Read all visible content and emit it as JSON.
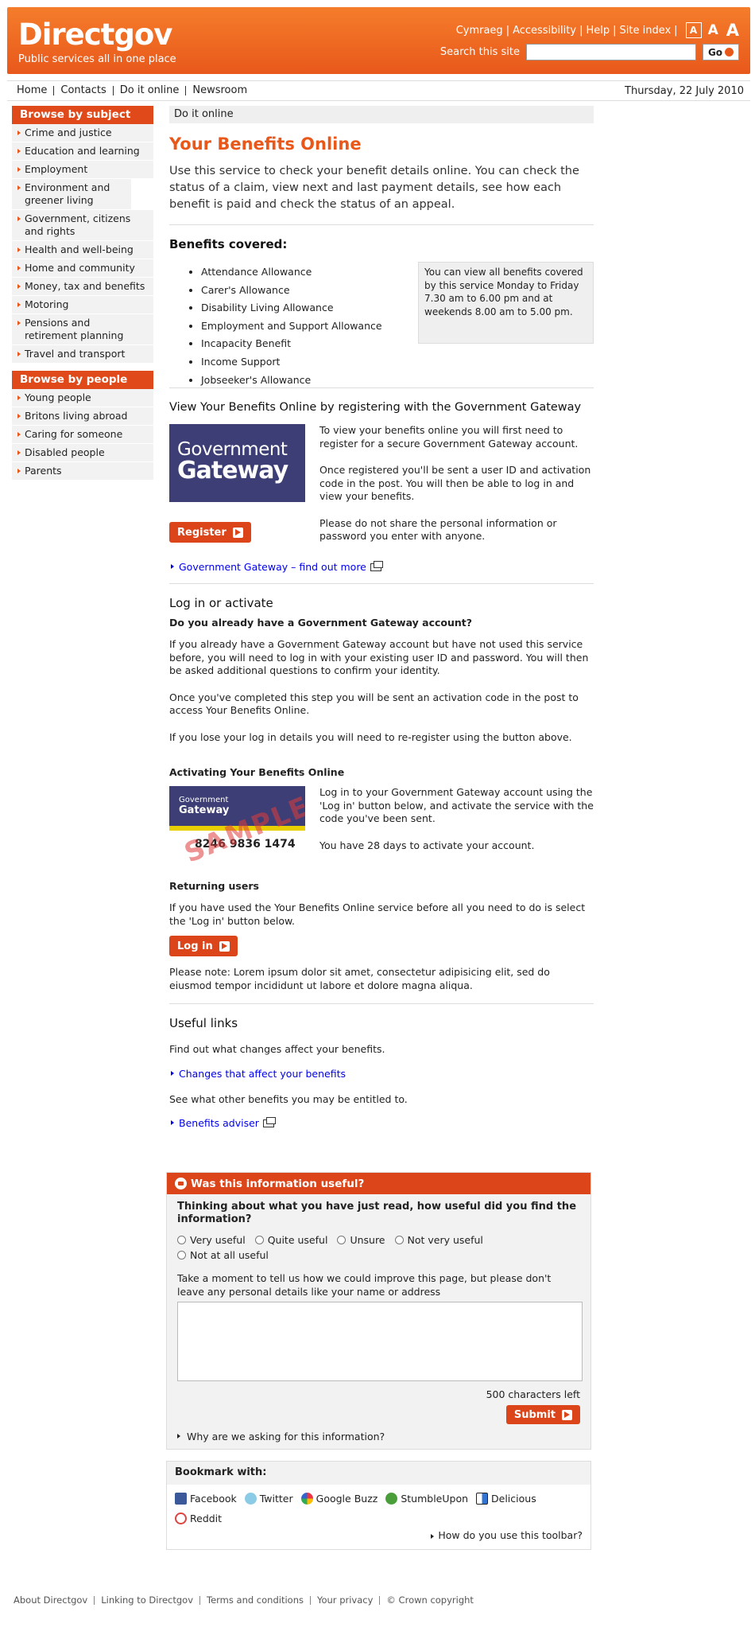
{
  "header": {
    "logo": "Directgov",
    "tagline": "Public services all in one place",
    "links": [
      "Cymraeg",
      "Accessibility",
      "Help",
      "Site index"
    ],
    "text_sizes": [
      "A",
      "A",
      "A"
    ],
    "search_label": "Search this site",
    "search_value": "",
    "go_label": "Go"
  },
  "nav": {
    "items": [
      "Home",
      "Contacts",
      "Do it online",
      "Newsroom"
    ],
    "date": "Thursday, 22 July 2010"
  },
  "sidebar": {
    "subject_heading": "Browse by subject",
    "subjects": [
      "Crime and justice",
      "Education and learning",
      "Employment",
      "Environment and greener living",
      "Government, citizens and rights",
      "Health and well-being",
      "Home and community",
      "Money, tax and benefits",
      "Motoring",
      "Pensions and retirement planning",
      "Travel and transport"
    ],
    "people_heading": "Browse by people",
    "people": [
      "Young people",
      "Britons living abroad",
      "Caring for someone",
      "Disabled people",
      "Parents"
    ]
  },
  "main": {
    "breadcrumb": "Do it online",
    "title": "Your Benefits Online",
    "intro": "Use this service to check your benefit details online. You can check the status of a claim, view next and last payment details, see how each benefit is paid and check the status of an appeal.",
    "benefits_heading": "Benefits covered:",
    "benefits": [
      "Attendance Allowance",
      "Carer's Allowance",
      "Disability Living Allowance",
      "Employment and Support Allowance",
      "Incapacity Benefit",
      "Income Support",
      "Jobseeker's Allowance"
    ],
    "benefits_info": "You can view all benefits covered by this service Monday to Friday 7.30 am to 6.00 pm and at weekends 8.00 am to 5.00 pm.",
    "register_heading": "View Your Benefits Online by registering with the Government Gateway",
    "gg_logo_line1": "Government",
    "gg_logo_line2": "Gateway",
    "register_p1": "To view your benefits online you will first need to register for a secure Government Gateway account.",
    "register_p2": "Once registered you'll be sent a user ID and activation code in the post. You will then be able to log in and view your benefits.",
    "register_p3": "Please do not share the personal information or password you enter with anyone.",
    "register_button": "Register",
    "gg_link": "Government Gateway – find out more",
    "login_heading": "Log in or activate",
    "login_sub": "Do you already have a Government Gateway account?",
    "login_p1": "If you already have a Government Gateway account but have not used this service before, you will need to log in with your existing user ID and password. You will then be asked additional questions to confirm your identity.",
    "login_p2": "Once you've completed this step you will be sent an activation code in the post to access Your Benefits Online.",
    "login_p3": "If you lose your log in details you will need to re-register using the button above.",
    "activating_heading": "Activating Your Benefits Online",
    "card_number": "8246 9836 1474",
    "card_sample": "SAMPLE",
    "activating_p1": "Log in to your Government Gateway account using the 'Log in' button below, and activate the service with the code you've been sent.",
    "activating_p2": "You have 28 days to activate your account.",
    "returning_heading": "Returning users",
    "returning_p": "If you have used the Your Benefits Online service before all you need to do is select the 'Log in' button below.",
    "login_button": "Log in",
    "note": "Please note: Lorem ipsum dolor sit amet, consectetur adipisicing elit, sed do eiusmod tempor incididunt ut labore et dolore magna aliqua.",
    "useful_heading": "Useful links",
    "useful_p1": "Find out what changes affect your benefits.",
    "useful_link1": "Changes that affect your benefits",
    "useful_p2": "See what other benefits you may be entitled to.",
    "useful_link2": "Benefits adviser"
  },
  "feedback": {
    "heading": "Was this information useful?",
    "question": "Thinking about what you have just read, how useful did you find the information?",
    "options": [
      "Very useful",
      "Quite useful",
      "Unsure",
      "Not very useful",
      "Not at all useful"
    ],
    "prompt": "Take a moment to tell us how we could improve this page, but please don't leave any personal details like your name or address",
    "chars_left": "500 characters left",
    "submit": "Submit",
    "why": "Why are we asking for this information?"
  },
  "bookmark": {
    "heading": "Bookmark with:",
    "services": [
      "Facebook",
      "Twitter",
      "Google Buzz",
      "StumbleUpon",
      "Delicious",
      "Reddit"
    ],
    "help": "How do you use this toolbar?"
  },
  "footer": {
    "links": [
      "About Directgov",
      "Linking to Directgov",
      "Terms and conditions",
      "Your privacy",
      "© Crown copyright"
    ]
  },
  "colors": {
    "brand": "#e8581b",
    "button": "#dc4519"
  }
}
